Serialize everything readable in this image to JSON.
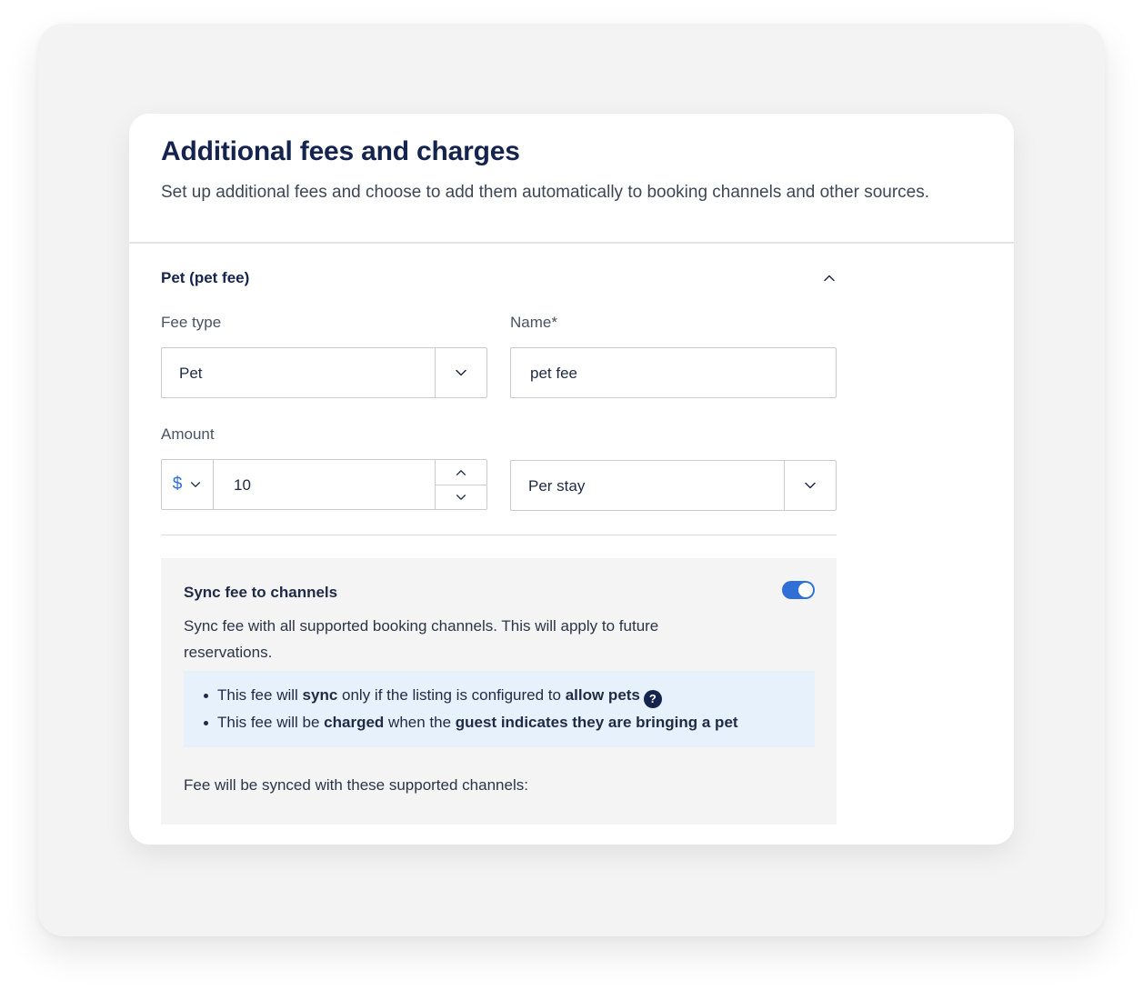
{
  "header": {
    "title": "Additional fees and charges",
    "subtitle": "Set up additional fees and choose to add them automatically to booking channels and other sources."
  },
  "fee": {
    "section_title": "Pet (pet fee)",
    "fee_type_label": "Fee type",
    "fee_type_value": "Pet",
    "name_label": "Name*",
    "name_value": "pet fee",
    "amount_label": "Amount",
    "currency_symbol": "$",
    "amount_value": "10",
    "frequency_value": "Per stay"
  },
  "sync": {
    "title": "Sync fee to channels",
    "enabled": true,
    "description": "Sync fee with all supported booking channels. This will apply to future reservations.",
    "info_1": {
      "pre": "This fee will ",
      "b1": "sync",
      "mid": " only if the listing is configured to ",
      "b2": "allow pets"
    },
    "help_glyph": "?",
    "info_2": {
      "pre": "This fee will be ",
      "b1": "charged",
      "mid": " when the ",
      "b2": "guest indicates they are bringing a pet"
    },
    "channels_note": "Fee will be synced with these supported channels:"
  },
  "colors": {
    "accent": "#2f6fd6",
    "title": "#14244f",
    "info_bg": "#e7f1fc",
    "panel_bg": "#f4f4f5"
  },
  "icons": [
    "chevron-up-icon",
    "chevron-down-icon",
    "help-icon",
    "toggle-switch"
  ]
}
